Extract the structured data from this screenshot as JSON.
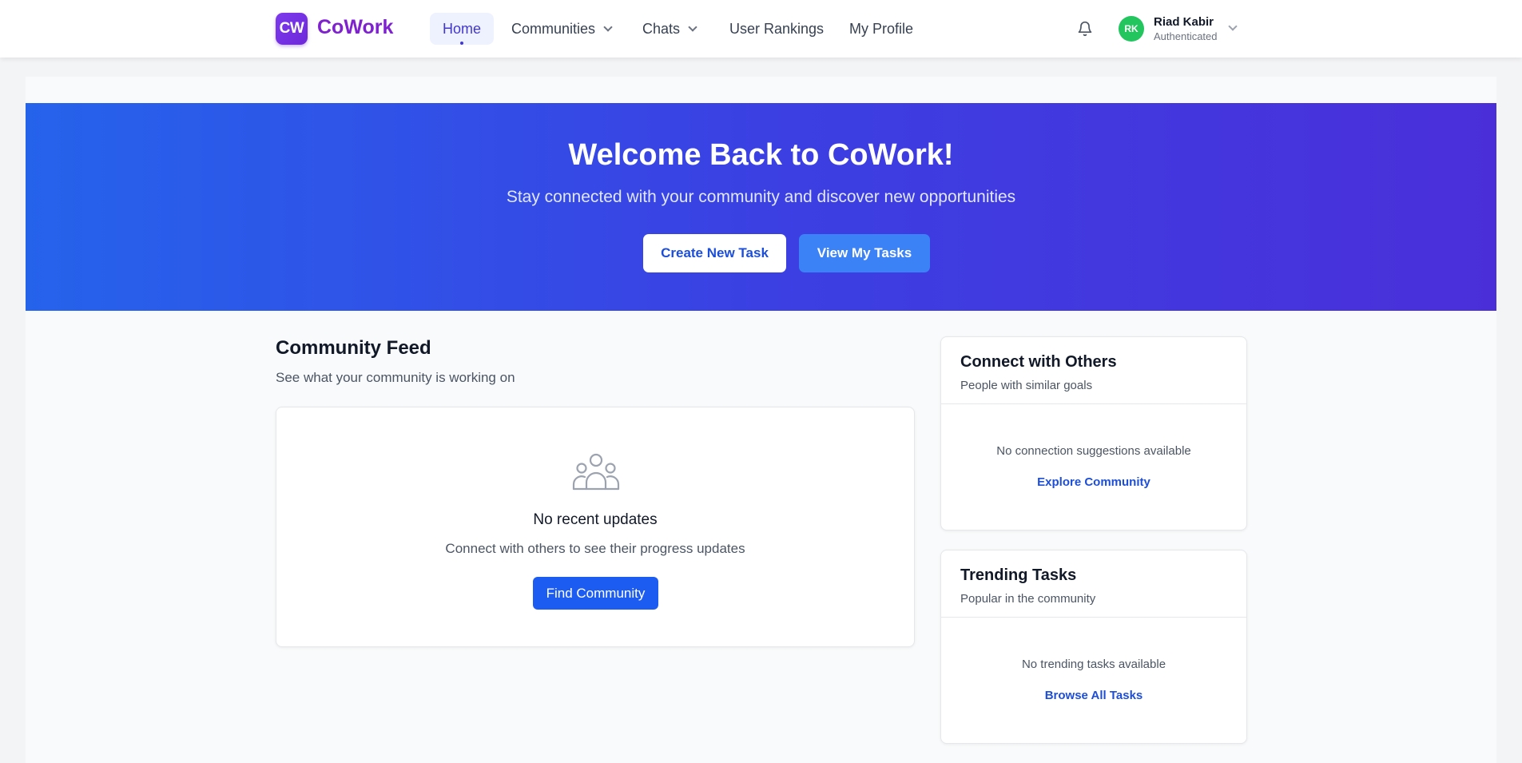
{
  "header": {
    "logo_badge": "CW",
    "brand": "CoWork",
    "nav": [
      {
        "label": "Home",
        "active": true
      },
      {
        "label": "Communities",
        "dropdown": true
      },
      {
        "label": "Chats",
        "dropdown": true
      },
      {
        "label": "User Rankings"
      },
      {
        "label": "My Profile"
      }
    ],
    "notification_icon": "bell-icon",
    "user": {
      "initials": "RK",
      "name": "Riad Kabir",
      "status": "Authenticated",
      "avatar_color": "#22c55e"
    }
  },
  "hero": {
    "title": "Welcome Back to CoWork!",
    "subtitle": "Stay connected with your community and discover new opportunities",
    "primary_button": "Create New Task",
    "secondary_button": "View My Tasks"
  },
  "feed": {
    "title": "Community Feed",
    "subtitle": "See what your community is working on",
    "empty_icon": "users-icon",
    "empty_title": "No recent updates",
    "empty_subtitle": "Connect with others to see their progress updates",
    "button": "Find Community"
  },
  "connect": {
    "title": "Connect with Others",
    "subtitle": "People with similar goals",
    "empty": "No connection suggestions available",
    "link": "Explore Community"
  },
  "trending": {
    "title": "Trending Tasks",
    "subtitle": "Popular in the community",
    "empty": "No trending tasks available",
    "link": "Browse All Tasks"
  },
  "colors": {
    "brand": "#7e22ce",
    "primary": "#1d5cf0",
    "hero_start": "#2563eb",
    "hero_end": "#4a2fd9"
  }
}
